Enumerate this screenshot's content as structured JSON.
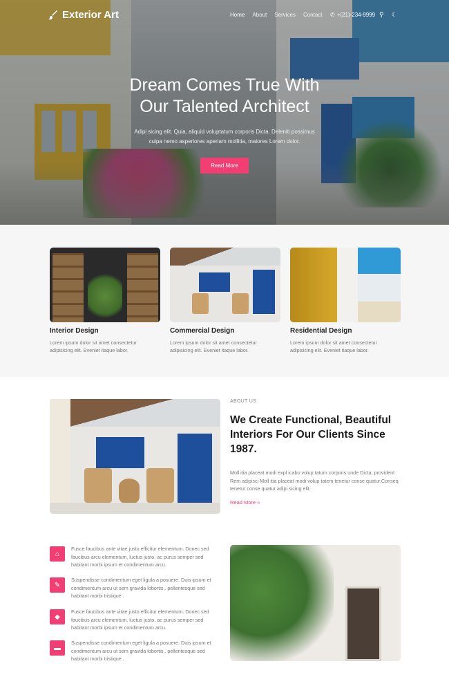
{
  "nav": {
    "logo": "Exterior Art",
    "menu": [
      "Home",
      "About",
      "Services",
      "Contact"
    ],
    "phone": "+(21)-234-9999"
  },
  "hero": {
    "title_line1": "Dream Comes True With",
    "title_line2": "Our Talented Architect",
    "subtitle": "Adipi sicing elit. Quia, aliquid voluptatum corporis Dicta. Deleniti possimus culpa nemo asperiores aperiam mollitia, maiores Lorem dolor.",
    "button": "Read More"
  },
  "services": [
    {
      "title": "Interior Design",
      "text": "Lorem ipsum dolor sit amet consectetur adipisicing elit. Eveniet itaque labor."
    },
    {
      "title": "Commercial Design",
      "text": "Lorem ipsum dolor sit amet consectetur adipisicing elit. Eveniet itaque labor."
    },
    {
      "title": "Residential Design",
      "text": "Lorem ipsum dolor sit amet consectetur adipisicing elit. Eveniet itaque labor."
    }
  ],
  "about": {
    "label": "ABOUT US",
    "title": "We Create Functional, Beautiful Interiors For Our Clients Since 1987.",
    "text": "Moll itia placeat modi expl icabo volup tatum corporis unde Dicta, provident Rem adipisci Moll itia placeat modi volup tatem tenetur conse quatur.Conseq tenetur conse quatur adipi sicing elit.",
    "link": "Read More »"
  },
  "features": [
    {
      "icon": "home-icon",
      "text": "Fusce faucibus ante vitae justo efficitur elementum. Donec sed faucibus arcu elementum, luctus justo. ac purus semper sed habitant morbi ipsum et condimentum arcu."
    },
    {
      "icon": "magic-wand-icon",
      "text": "Suspendisse condimentum eget ligula a posuere. Duis ipsum et condimentum arcu ut sem gravida lobortis,. pellentesque sed habitant morbi tristique ."
    },
    {
      "icon": "diamond-icon",
      "text": "Fusce faucibus ante vitae justo efficitur elementum. Donec sed faucibus arcu elementum, luctus justo. ac purus semper sed habitant morbi ipsum et condimentum arcu."
    },
    {
      "icon": "bathtub-icon",
      "text": "Suspendisse condimentum eget ligula a posuere. Duis ipsum et condimentum arcu ut sem gravida lobortis,. pellentesque sed habitant morbi tristique ."
    }
  ],
  "colors": {
    "accent": "#f13f74",
    "heading": "#1b1b1b",
    "muted": "#777777",
    "section_bg": "#f6f6f7"
  }
}
